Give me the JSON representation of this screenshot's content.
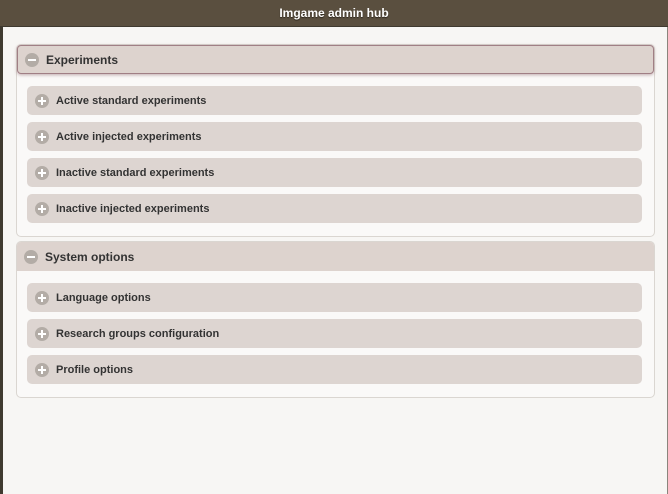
{
  "header": {
    "title": "Imgame admin hub"
  },
  "sections": [
    {
      "title": "Experiments",
      "items": [
        {
          "label": "Active standard experiments"
        },
        {
          "label": "Active injected experiments"
        },
        {
          "label": "Inactive standard experiments"
        },
        {
          "label": "Inactive injected experiments"
        }
      ]
    },
    {
      "title": "System options",
      "items": [
        {
          "label": "Language options"
        },
        {
          "label": "Research groups configuration"
        },
        {
          "label": "Profile options"
        }
      ]
    }
  ],
  "icons": {
    "expanded": "minus-circle-icon",
    "collapsed": "plus-circle-icon"
  },
  "colors": {
    "header_bg": "#5a4f3f",
    "section_header_bg": "#ddd3ce",
    "item_bg": "#ddd5d1"
  }
}
